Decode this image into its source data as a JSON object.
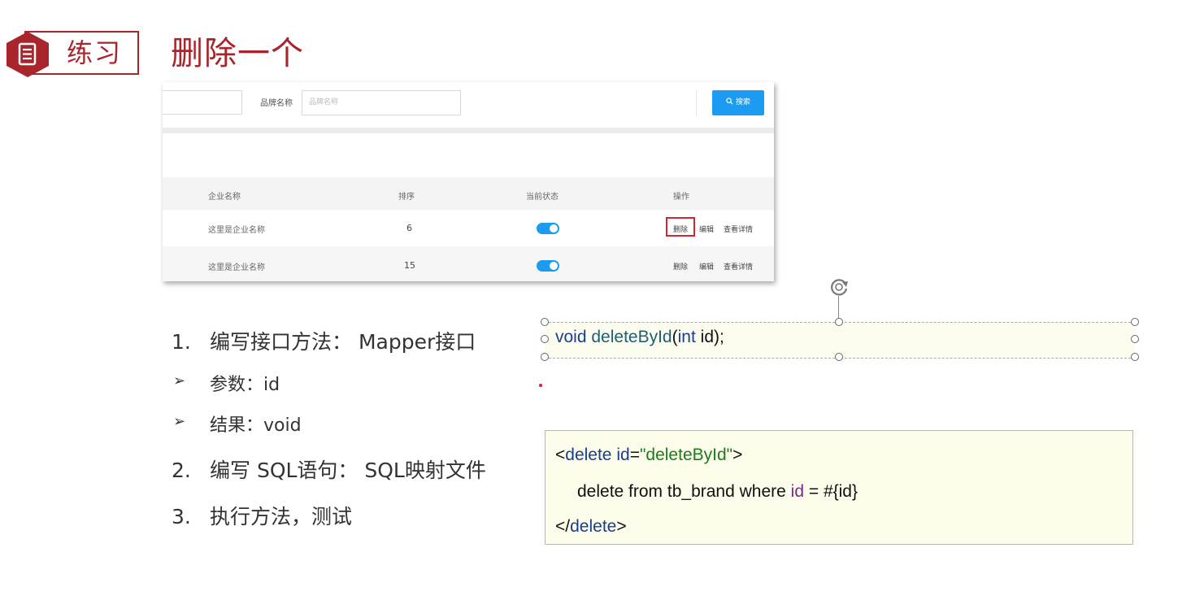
{
  "header": {
    "section_label": "练习",
    "title": "删除一个",
    "icon": "document-icon",
    "accent_color": "#a8262b"
  },
  "screenshot": {
    "brand_label": "品牌名称",
    "brand_placeholder": "品牌名称",
    "search_button": "搜索",
    "search_icon": "search-icon",
    "columns": [
      "企业名称",
      "排序",
      "当前状态",
      "操作"
    ],
    "rows": [
      {
        "name": "这里是企业名称",
        "order": "6",
        "status_on": true,
        "actions": [
          "删除",
          "编辑",
          "查看详情"
        ]
      },
      {
        "name": "这里是企业名称",
        "order": "15",
        "status_on": true,
        "actions": [
          "删除",
          "编辑",
          "查看详情"
        ]
      }
    ],
    "accent_color": "#1c9bf2",
    "highlight_color": "#d2262f"
  },
  "steps": {
    "s1_num": "1.",
    "s1_text": "编写接口方法： Mapper接口",
    "sub1": "参数：id",
    "sub2": "结果：void",
    "s2_num": "2.",
    "s2_text": "编写 SQL语句： SQL映射文件",
    "s3_num": "3.",
    "s3_text": "执行方法，测试"
  },
  "code_interface": {
    "kw_void": "void",
    "method": "deleteById",
    "open_paren": "(",
    "kw_int": "int",
    "param": "id",
    "close": ");"
  },
  "code_xml": {
    "open_lt": "<",
    "open_tag": "delete",
    "attr_name": "id",
    "attr_eq": "=",
    "attr_value": "\"deleteById\"",
    "open_gt": ">",
    "sql_prefix": "delete from tb_brand where ",
    "sql_field": "id",
    "sql_suffix": " = #{id}",
    "close_lt": "</",
    "close_tag": "delete",
    "close_gt": ">"
  }
}
